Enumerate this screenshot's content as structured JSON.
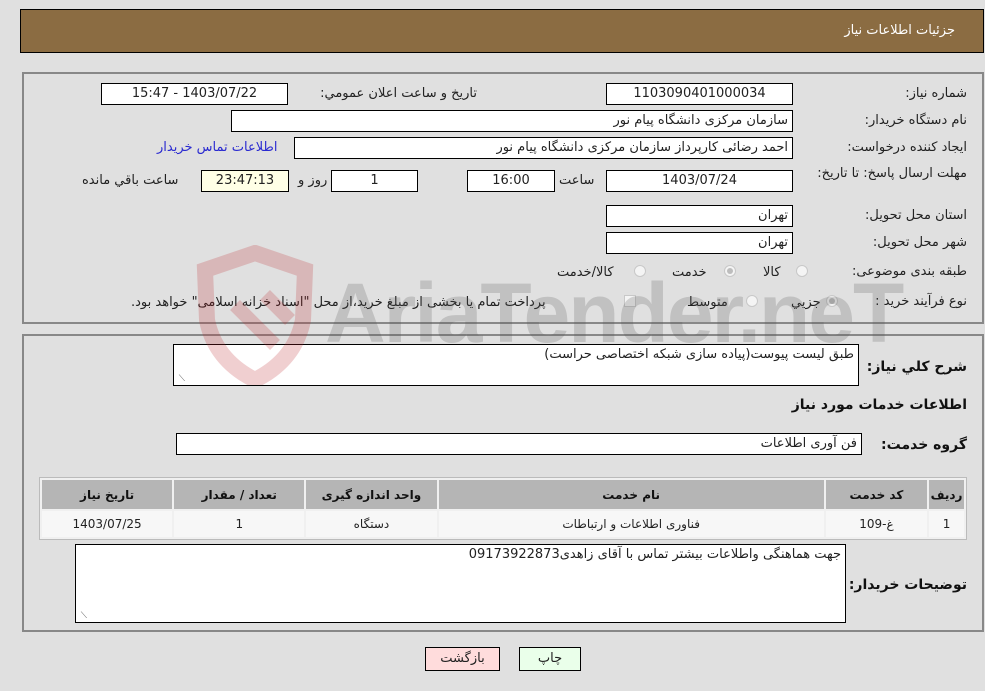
{
  "header": {
    "title": "جزئيات اطلاعات نياز"
  },
  "form": {
    "need_number": {
      "label": "شماره نياز:",
      "value": "1103090401000034"
    },
    "announce_datetime": {
      "label": "تاريخ و ساعت اعلان عمومي:",
      "value": "1403/07/22 - 15:47"
    },
    "buyer_org": {
      "label": "نام دستگاه خريدار:",
      "value": "سازمان مرکزی دانشگاه پيام نور"
    },
    "requester": {
      "label": "ايجاد کننده درخواست:",
      "value": "احمد رضائی کارپرداز سازمان مرکزی دانشگاه پیام نور"
    },
    "buyer_contact_link": "اطلاعات تماس خريدار",
    "deadline": {
      "label": "مهلت ارسال پاسخ: تا تاريخ:",
      "date": "1403/07/24",
      "time_label": "ساعت",
      "time": "16:00",
      "days": "1",
      "days_label": "روز و",
      "remaining": "23:47:13",
      "remaining_label": "ساعت باقي مانده"
    },
    "province": {
      "label": "استان محل تحويل:",
      "value": "تهران"
    },
    "city": {
      "label": "شهر محل تحويل:",
      "value": "تهران"
    },
    "category": {
      "label": "طبقه بندی موضوعی:",
      "options": [
        {
          "label": "کالا",
          "checked": false
        },
        {
          "label": "خدمت",
          "checked": true
        },
        {
          "label": "کالا/خدمت",
          "checked": false
        }
      ]
    },
    "purchase_process": {
      "label": "نوع فرآيند خريد :",
      "options": [
        {
          "label": "جزيي",
          "checked": true
        },
        {
          "label": "متوسط",
          "checked": false
        }
      ],
      "treasury_note": "پرداخت تمام يا بخشی از مبلغ خريد،از محل \"اسناد خزانه اسلامی\" خواهد بود."
    }
  },
  "details": {
    "description_label": "شرح کلي نياز:",
    "description": "طبق لیست پیوست(پیاده سازی شبکه اختصاصی حراست)",
    "services_heading": "اطلاعات خدمات مورد نياز",
    "service_group_label": "گروه خدمت:",
    "service_group": "فن آوری اطلاعات",
    "table": {
      "headers": [
        "رديف",
        "کد خدمت",
        "نام خدمت",
        "واحد اندازه گيری",
        "تعداد / مقدار",
        "تاريخ نياز"
      ],
      "rows": [
        [
          "1",
          "غ-109",
          "فناوری اطلاعات و ارتباطات",
          "دستگاه",
          "1",
          "1403/07/25"
        ]
      ]
    },
    "buyer_notes_label": "توضيحات خريدار:",
    "buyer_notes": "جهت هماهنگی واطلاعات بیشتر تماس با آقای زاهدی09173922873"
  },
  "buttons": {
    "print": "چاپ",
    "back": "بازگشت"
  },
  "colors": {
    "header_bg": "#8b6c42",
    "print_bg": "#eaffea",
    "back_bg": "#ffdcdc",
    "link": "#2a2ad0"
  },
  "watermark": {
    "text": "AriaTender.neT"
  }
}
